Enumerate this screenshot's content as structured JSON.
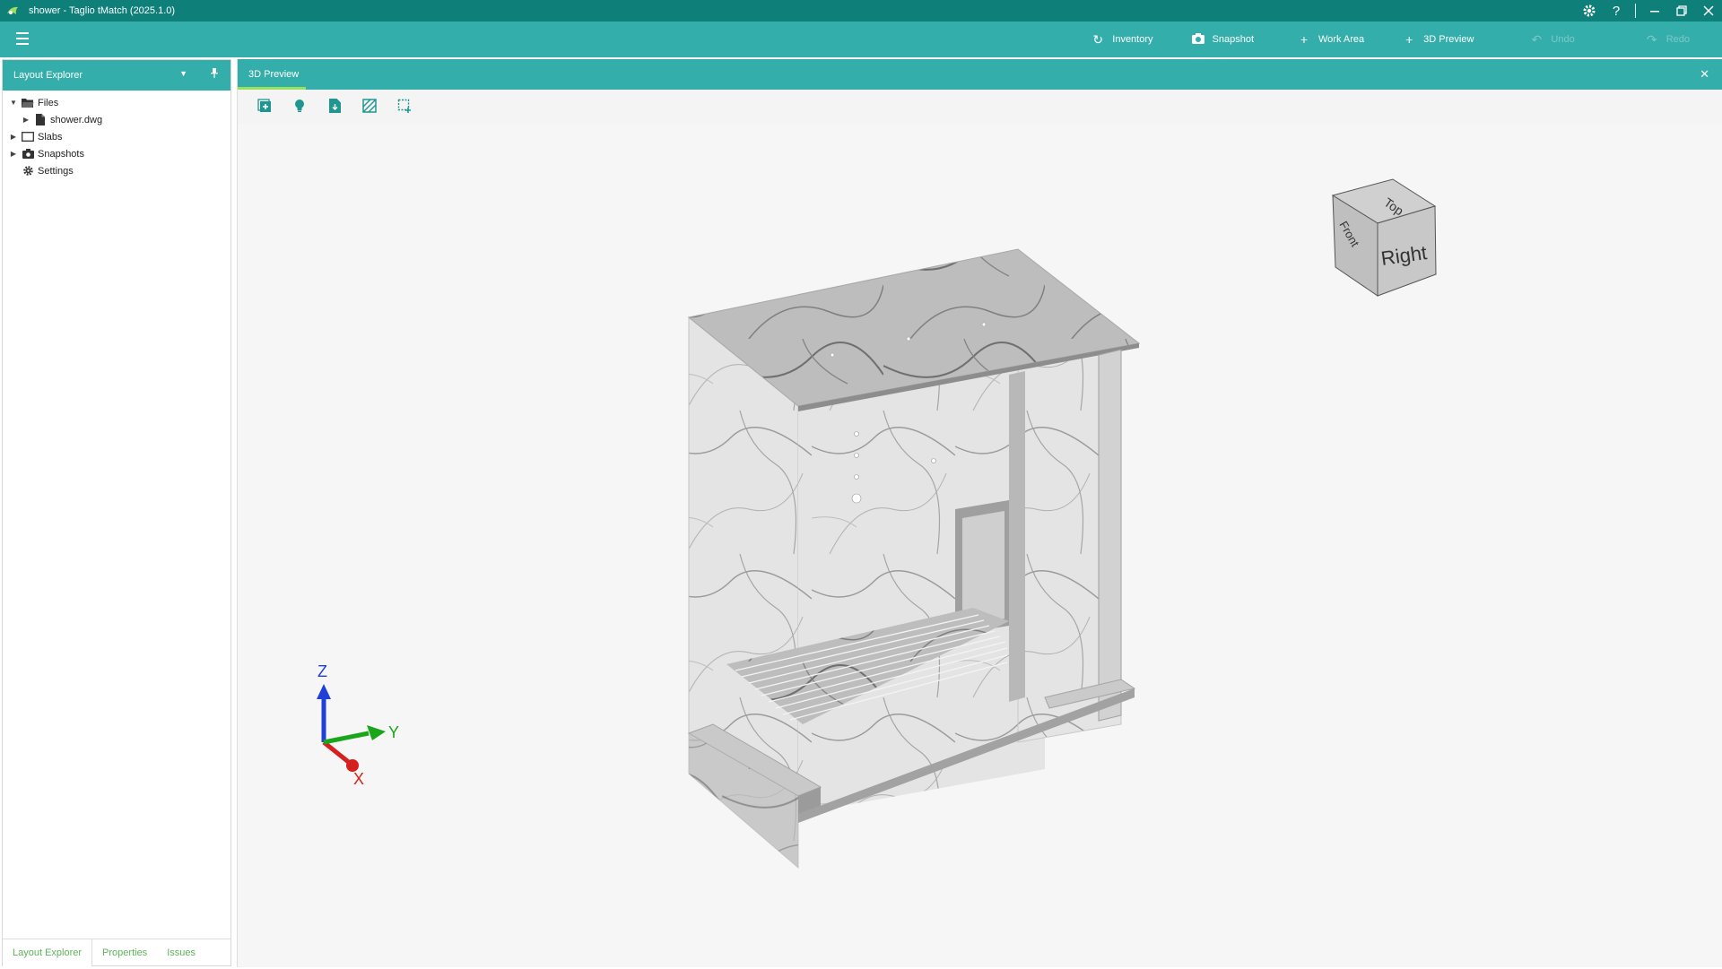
{
  "window": {
    "title": "shower - Taglio tMatch (2025.1.0)"
  },
  "toolbar": {
    "actions": [
      {
        "label": "Inventory",
        "icon": "refresh-icon",
        "enabled": true
      },
      {
        "label": "Snapshot",
        "icon": "camera-icon",
        "enabled": true
      },
      {
        "label": "Work Area",
        "icon": "plus-icon",
        "enabled": true
      },
      {
        "label": "3D Preview",
        "icon": "plus-icon",
        "enabled": true
      },
      {
        "label": "Undo",
        "icon": "undo-icon",
        "enabled": false
      },
      {
        "label": "Redo",
        "icon": "redo-icon",
        "enabled": false
      }
    ]
  },
  "layout_explorer": {
    "title": "Layout Explorer",
    "tree": {
      "files": "Files",
      "file_item": "shower.dwg",
      "slabs": "Slabs",
      "snapshots": "Snapshots",
      "settings": "Settings"
    },
    "tabs": [
      "Layout Explorer",
      "Properties",
      "Issues"
    ]
  },
  "document": {
    "tab": "3D Preview",
    "view_cube": {
      "top": "Top",
      "front": "Front",
      "right": "Right"
    },
    "axes": {
      "x": "X",
      "y": "Y",
      "z": "Z"
    }
  },
  "colors": {
    "title_bar": "#0f7f7a",
    "toolbar": "#34aeaa",
    "accent_green": "#5fb25b",
    "axis_x": "#d62020",
    "axis_y": "#1aa61a",
    "axis_z": "#2040d8"
  }
}
